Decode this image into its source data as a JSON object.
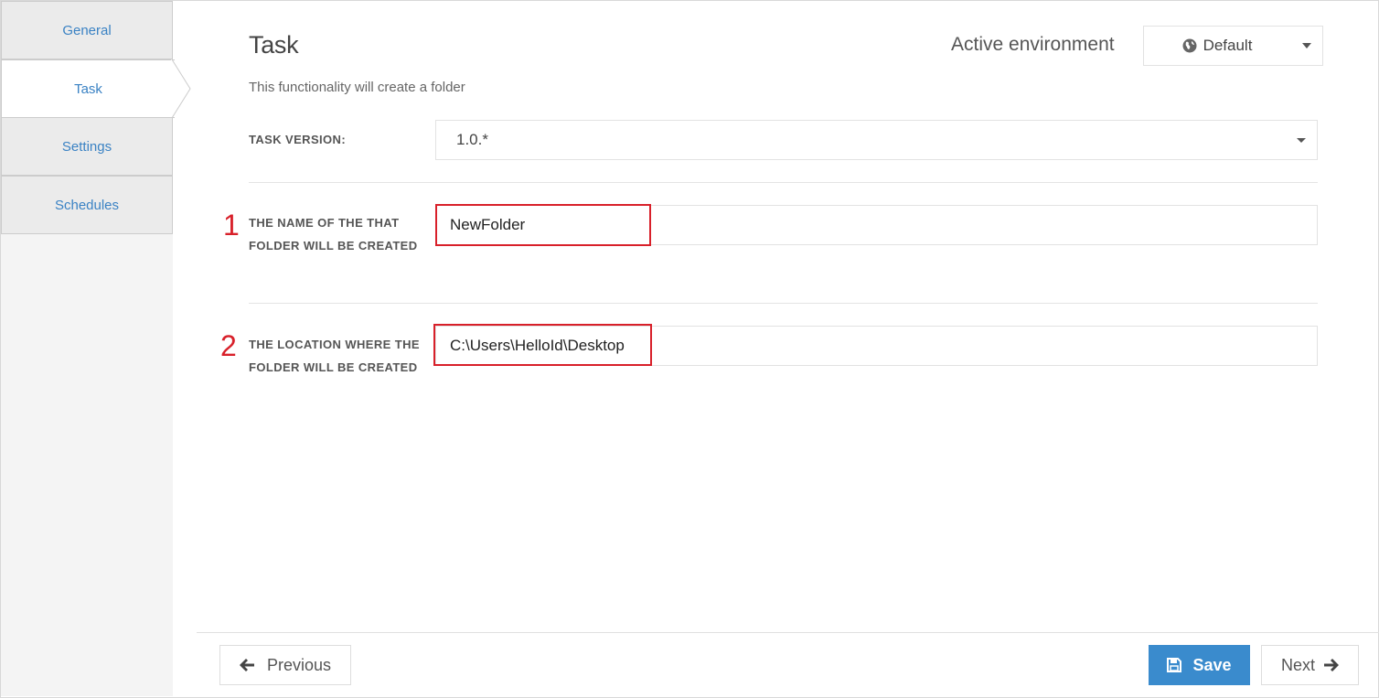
{
  "sidebar": {
    "tabs": [
      {
        "label": "General",
        "active": false
      },
      {
        "label": "Task",
        "active": true
      },
      {
        "label": "Settings",
        "active": false
      },
      {
        "label": "Schedules",
        "active": false
      }
    ]
  },
  "header": {
    "title": "Task",
    "subtitle": "This functionality will create a folder",
    "env_label": "Active environment",
    "env_value": "Default",
    "env_icon": "globe-icon"
  },
  "form": {
    "task_version": {
      "label": "TASK VERSION:",
      "value": "1.0.*"
    },
    "folder_name": {
      "marker": "1",
      "label": "THE NAME OF THE THAT FOLDER WILL BE CREATED",
      "value": "NewFolder"
    },
    "folder_location": {
      "marker": "2",
      "label": "THE LOCATION WHERE THE FOLDER WILL BE CREATED",
      "value": "C:\\Users\\HelloId\\Desktop"
    }
  },
  "footer": {
    "previous_label": "Previous",
    "save_label": "Save",
    "next_label": "Next"
  },
  "colors": {
    "accent": "#3a8bcd",
    "link": "#3a82c4",
    "highlight": "#d8202a"
  }
}
